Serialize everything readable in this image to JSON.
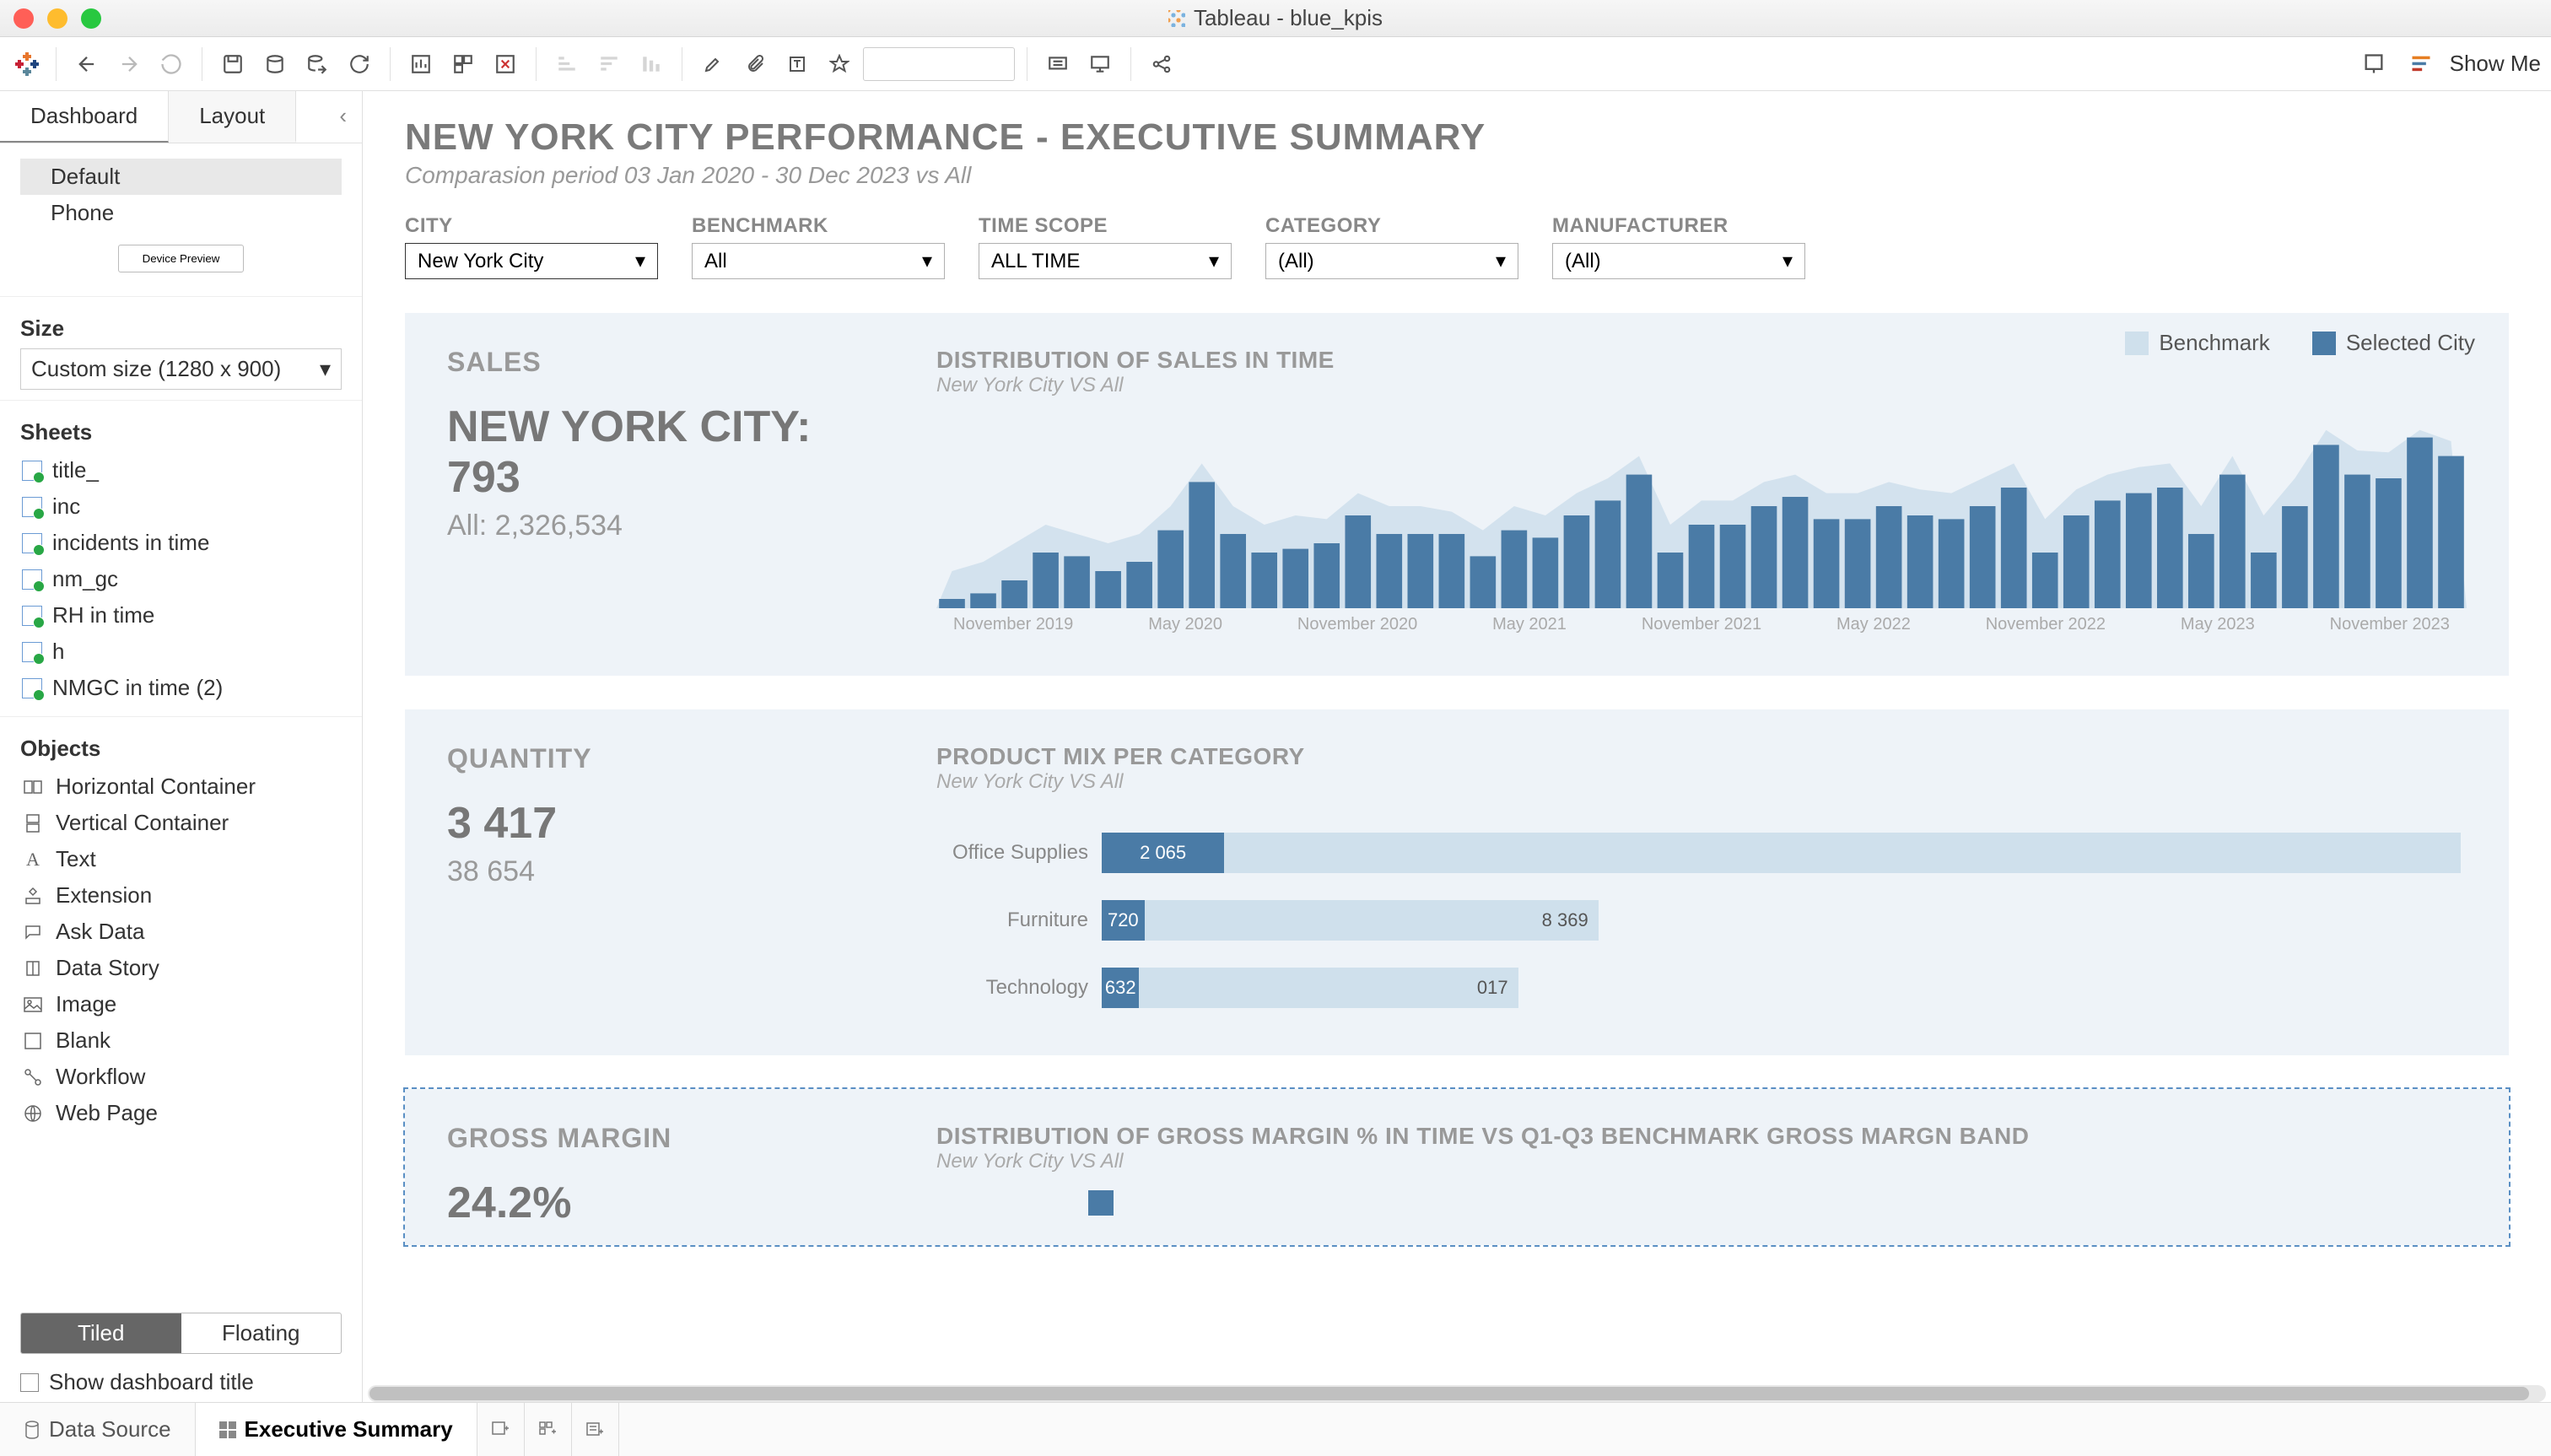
{
  "window": {
    "title": "Tableau - blue_kpis"
  },
  "sidebar": {
    "tabs": {
      "dashboard": "Dashboard",
      "layout": "Layout"
    },
    "devices": [
      "Default",
      "Phone"
    ],
    "devicePreview": "Device Preview",
    "sizeLabel": "Size",
    "sizeValue": "Custom size (1280 x 900)",
    "sheetsLabel": "Sheets",
    "sheets": [
      "title_",
      "inc",
      "incidents in time",
      "nm_gc",
      "RH in time",
      "h",
      "NMGC in time (2)"
    ],
    "objectsLabel": "Objects",
    "objects": [
      "Horizontal Container",
      "Vertical Container",
      "Text",
      "Extension",
      "Ask Data",
      "Data Story",
      "Image",
      "Blank",
      "Workflow",
      "Web Page"
    ],
    "tiled": "Tiled",
    "floating": "Floating",
    "showTitle": "Show dashboard title"
  },
  "toolbar": {
    "showMe": "Show Me"
  },
  "dashboard": {
    "title": "NEW YORK CITY PERFORMANCE - EXECUTIVE SUMMARY",
    "subtitle": "Comparasion period 03 Jan 2020 - 30 Dec 2023 vs All",
    "filters": [
      {
        "label": "CITY",
        "value": "New York City",
        "hl": true
      },
      {
        "label": "BENCHMARK",
        "value": "All",
        "hl": false
      },
      {
        "label": "TIME SCOPE",
        "value": "ALL TIME",
        "hl": false
      },
      {
        "label": "CATEGORY",
        "value": "(All)",
        "hl": false
      },
      {
        "label": "MANUFACTURER",
        "value": "(All)",
        "hl": false
      }
    ],
    "legend": {
      "benchmark": "Benchmark",
      "selected": "Selected City"
    },
    "colors": {
      "bar": "#4a7ba6",
      "bench": "#cfe0ec"
    },
    "sales": {
      "label": "SALES",
      "main": "NEW YORK CITY: 793",
      "sub": "All: 2,326,534",
      "chartTitle": "DISTRIBUTION OF SALES IN TIME",
      "chartSub": "New York City VS All"
    },
    "quantity": {
      "label": "QUANTITY",
      "main": "3 417",
      "sub": "38 654",
      "chartTitle": "PRODUCT MIX PER CATEGORY",
      "chartSub": "New York City VS All"
    },
    "margin": {
      "label": "GROSS MARGIN",
      "main": "24.2%",
      "chartTitle": "DISTRIBUTION OF GROSS MARGIN % IN TIME VS Q1-Q3 BENCHMARK GROSS MARGN BAND",
      "chartSub": "New York City VS All"
    }
  },
  "chart_data": [
    {
      "type": "bar",
      "title": "DISTRIBUTION OF SALES IN TIME",
      "series": [
        {
          "name": "Selected City",
          "values": [
            5,
            8,
            15,
            30,
            28,
            20,
            25,
            42,
            68,
            40,
            30,
            32,
            35,
            50,
            40,
            40,
            40,
            28,
            42,
            38,
            50,
            58,
            72,
            30,
            45,
            45,
            55,
            60,
            48,
            48,
            55,
            50,
            48,
            55,
            65,
            30,
            50,
            58,
            62,
            65,
            40,
            72,
            30,
            55,
            88,
            72,
            70,
            92,
            82
          ]
        },
        {
          "name": "Benchmark",
          "values": [
            20,
            25,
            35,
            45,
            40,
            35,
            40,
            55,
            78,
            55,
            45,
            50,
            48,
            62,
            55,
            55,
            52,
            42,
            55,
            50,
            62,
            70,
            82,
            45,
            58,
            58,
            68,
            72,
            62,
            62,
            68,
            64,
            62,
            70,
            78,
            48,
            64,
            72,
            76,
            78,
            55,
            82,
            50,
            70,
            96,
            85,
            84,
            96,
            90
          ]
        }
      ],
      "x_ticks": [
        "November 2019",
        "May 2020",
        "November 2020",
        "May 2021",
        "November 2021",
        "May 2022",
        "November 2022",
        "May 2023",
        "November 2023"
      ],
      "ylim": [
        0,
        100
      ]
    },
    {
      "type": "bar",
      "title": "PRODUCT MIX PER CATEGORY",
      "orientation": "horizontal",
      "categories": [
        "Office Supplies",
        "Furniture",
        "Technology"
      ],
      "series": [
        {
          "name": "Selected City",
          "values": [
            2065,
            720,
            632
          ]
        },
        {
          "name": "Benchmark",
          "values": [
            22906,
            8369,
            7017
          ]
        }
      ],
      "xlim": [
        0,
        23000
      ],
      "labels_selected": [
        "2 065",
        "720",
        "632"
      ],
      "labels_bench": [
        "",
        "8 369",
        "017"
      ]
    }
  ],
  "bottombar": {
    "dataSource": "Data Source",
    "activeSheet": "Executive Summary"
  }
}
